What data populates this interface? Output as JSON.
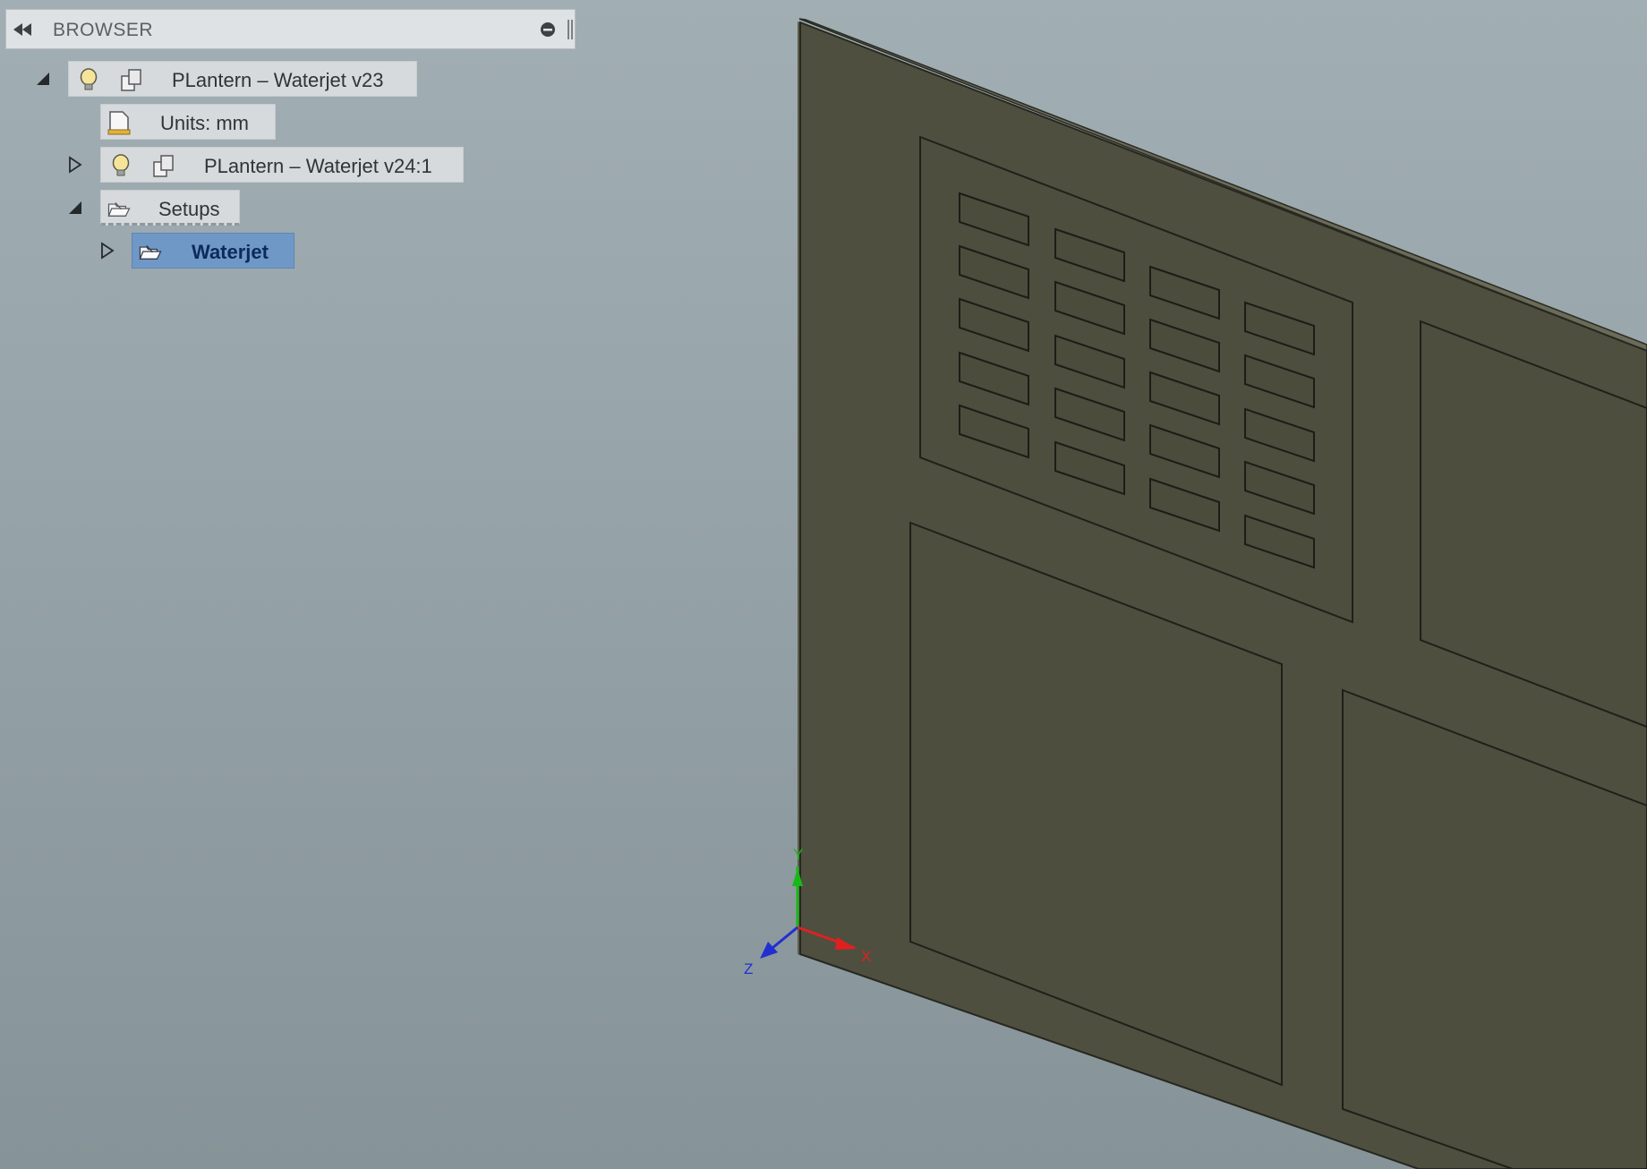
{
  "browser": {
    "title": "BROWSER",
    "tree": [
      {
        "label": "PLantern – Waterjet v23",
        "expanded": true,
        "icons": [
          "lightbulb-icon",
          "component-icon"
        ]
      },
      {
        "label": "Units: mm",
        "icons": [
          "units-document-icon"
        ]
      },
      {
        "label": "PLantern – Waterjet v24:1",
        "expanded": false,
        "icons": [
          "lightbulb-icon",
          "component-icon"
        ]
      },
      {
        "label": "Setups",
        "expanded": true,
        "icons": [
          "setups-folder-icon"
        ]
      },
      {
        "label": "Waterjet",
        "expanded": false,
        "selected": true,
        "icons": [
          "setup-folder-icon"
        ]
      }
    ]
  },
  "axes": {
    "x": "X",
    "y": "Y",
    "z": "Z"
  },
  "colors": {
    "background": "#97a4aa",
    "panel": "#4e4f3f",
    "selection": "#6f98c6",
    "axis_x": "#e02020",
    "axis_y": "#18b818",
    "axis_z": "#2030d0"
  }
}
